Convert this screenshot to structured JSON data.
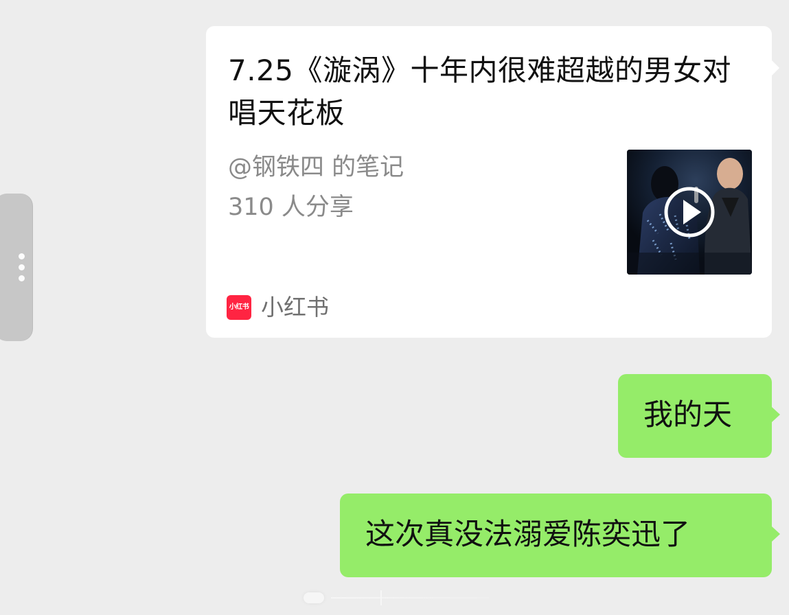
{
  "shared_card": {
    "title": "7.25《漩涡》十年内很难超越的男女对唱天花板",
    "author": "@钢铁四 的笔记",
    "shares": "310 人分享",
    "source_name": "小红书",
    "source_logo_text": "小红书"
  },
  "messages": [
    {
      "text": "我的天"
    },
    {
      "text": "这次真没法溺爱陈奕迅了"
    }
  ],
  "colors": {
    "chat_background": "#ededed",
    "sent_bubble": "#95ec69",
    "card_background": "#ffffff",
    "source_brand": "#ff2442"
  },
  "icons": {
    "side_handle": "vertical-dots-icon",
    "play": "play-icon",
    "source": "xiaohongshu-logo-icon"
  }
}
